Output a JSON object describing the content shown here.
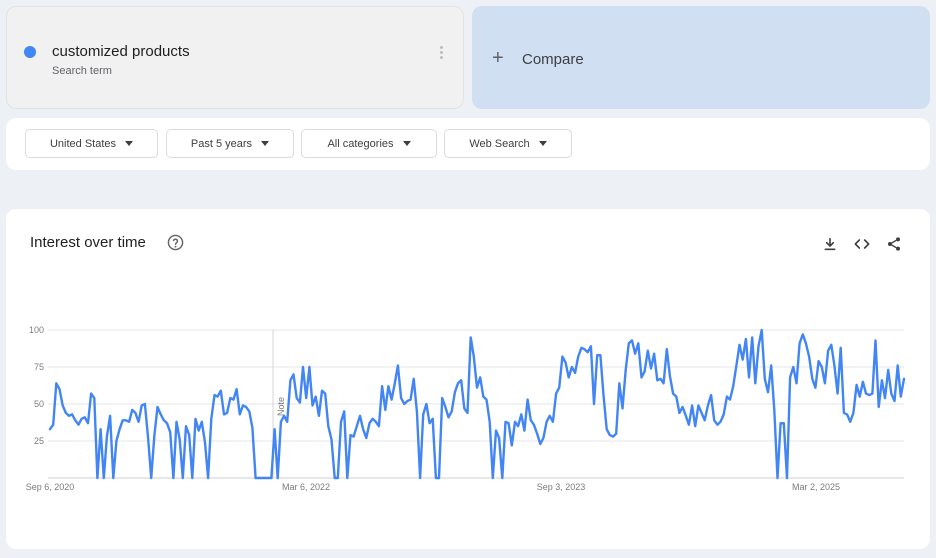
{
  "search_term": {
    "name": "customized products",
    "subtitle": "Search term",
    "color": "#4285f4"
  },
  "compare": {
    "label": "Compare",
    "plus": "+"
  },
  "filters": [
    {
      "label": "United States"
    },
    {
      "label": "Past 5 years"
    },
    {
      "label": "All categories"
    },
    {
      "label": "Web Search"
    }
  ],
  "chart_panel": {
    "title": "Interest over time"
  },
  "icons": [
    "help-icon",
    "download-icon",
    "embed-code-icon",
    "share-icon",
    "more-vert-icon"
  ],
  "chart_data": {
    "type": "line",
    "series": [
      {
        "name": "customized products",
        "color": "#4285f4",
        "values": [
          33,
          36,
          64,
          60,
          49,
          44,
          42,
          43,
          39,
          36,
          40,
          41,
          37,
          57,
          54,
          0,
          33,
          0,
          28,
          42,
          0,
          25,
          33,
          39,
          39,
          38,
          46,
          44,
          38,
          49,
          50,
          27,
          0,
          29,
          48,
          43,
          39,
          37,
          31,
          0,
          38,
          26,
          0,
          35,
          29,
          0,
          40,
          32,
          38,
          24,
          0,
          40,
          56,
          55,
          59,
          43,
          44,
          54,
          53,
          60,
          43,
          49,
          48,
          45,
          34,
          0,
          0,
          0,
          0,
          0,
          0,
          33,
          0,
          38,
          42,
          38,
          66,
          70,
          54,
          51,
          75,
          54,
          75,
          49,
          55,
          42,
          59,
          57,
          35,
          26,
          0,
          0,
          38,
          45,
          0,
          29,
          28,
          35,
          42,
          33,
          27,
          37,
          40,
          38,
          35,
          62,
          46,
          62,
          53,
          64,
          76,
          54,
          50,
          52,
          53,
          67,
          45,
          0,
          43,
          50,
          37,
          40,
          0,
          0,
          54,
          48,
          41,
          45,
          58,
          64,
          66,
          47,
          44,
          95,
          82,
          61,
          68,
          55,
          53,
          38,
          0,
          32,
          27,
          0,
          38,
          37,
          22,
          38,
          35,
          43,
          32,
          53,
          39,
          36,
          30,
          23,
          27,
          38,
          42,
          38,
          57,
          61,
          82,
          78,
          68,
          75,
          71,
          82,
          88,
          87,
          85,
          89,
          50,
          83,
          83,
          56,
          33,
          29,
          28,
          30,
          64,
          47,
          73,
          91,
          93,
          84,
          91,
          68,
          72,
          86,
          74,
          84,
          66,
          67,
          64,
          87,
          69,
          57,
          55,
          44,
          48,
          42,
          36,
          49,
          35,
          49,
          44,
          39,
          49,
          56,
          39,
          36,
          38,
          43,
          55,
          53,
          62,
          76,
          90,
          80,
          94,
          68,
          95,
          64,
          89,
          100,
          67,
          58,
          76,
          46,
          0,
          37,
          37,
          0,
          68,
          75,
          64,
          91,
          97,
          91,
          82,
          67,
          61,
          79,
          75,
          64,
          86,
          90,
          76,
          57,
          88,
          44,
          43,
          38,
          44,
          63,
          55,
          65,
          57,
          56,
          57,
          93,
          48,
          66,
          54,
          73,
          57,
          52,
          76,
          55,
          67
        ]
      }
    ],
    "x_tick_labels": [
      "Sep 6, 2020",
      "Mar 6, 2022",
      "Sep 3, 2023",
      "Mar 2, 2025"
    ],
    "y_ticks": [
      25,
      50,
      75,
      100
    ],
    "ylim": [
      0,
      100
    ],
    "note_label": "Note",
    "grid": true,
    "legend": "none"
  }
}
